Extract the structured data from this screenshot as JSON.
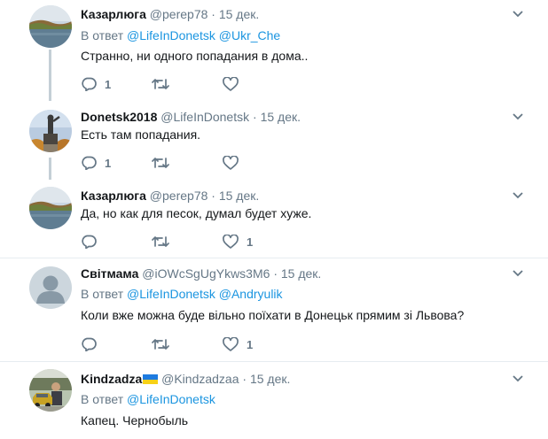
{
  "tweets": [
    {
      "name": "Казарлюга",
      "handle": "@pereр78",
      "date": "15 дек.",
      "reply_prefix": "В ответ",
      "reply_mentions": [
        "@LifeInDonetsk",
        "@Ukr_Che"
      ],
      "text": "Странно, ни одного попадания в дома..",
      "reply_count": "1",
      "retweet_count": "",
      "like_count": ""
    },
    {
      "name": "Donetsk2018",
      "handle": "@LifeInDonetsk",
      "date": "15 дек.",
      "text": "Есть там попадания.",
      "reply_count": "1",
      "retweet_count": "",
      "like_count": ""
    },
    {
      "name": "Казарлюга",
      "handle": "@pereр78",
      "date": "15 дек.",
      "text": "Да, но как для песок, думал будет хуже.",
      "reply_count": "",
      "retweet_count": "",
      "like_count": "1"
    },
    {
      "name": "Світмама",
      "handle": "@iOWcSgUgYkws3M6",
      "date": "15 дек.",
      "reply_prefix": "В ответ",
      "reply_mentions": [
        "@LifeInDonetsk",
        "@Andryulik"
      ],
      "text": "Коли вже можна буде вільно поїхати в Донецьк  прямим зі Львова?",
      "reply_count": "",
      "retweet_count": "",
      "like_count": "1"
    },
    {
      "name": "Kindzadza",
      "handle": "@Kindzadzaa",
      "date": "15 дек.",
      "reply_prefix": "В ответ",
      "reply_mentions": [
        "@LifeInDonetsk"
      ],
      "text": "Капец.  Чернобыль"
    }
  ],
  "icons": {
    "reply": "reply-icon",
    "retweet": "retweet-icon",
    "like": "heart-icon",
    "menu": "chevron-down-icon"
  },
  "colors": {
    "link": "#1b95e0",
    "muted": "#657786",
    "separator": "#e6ecf0",
    "thread_line": "#c4cfd6"
  }
}
